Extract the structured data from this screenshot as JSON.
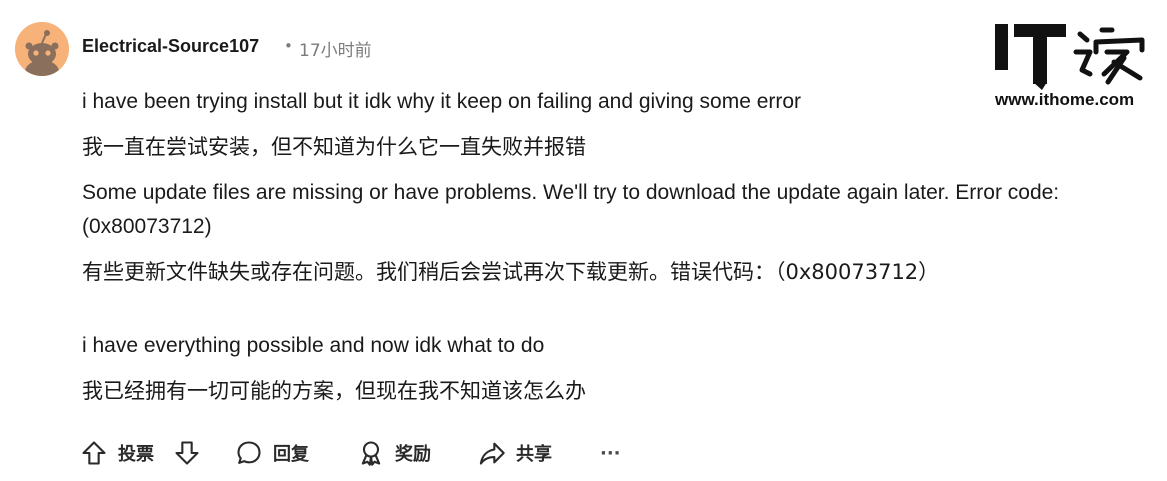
{
  "comment": {
    "author": "Electrical-Source107",
    "separator": "•",
    "time": "17小时前",
    "lines": [
      "i have been trying install but it idk why it keep on failing and giving some error",
      "我一直在尝试安装，但不知道为什么它一直失败并报错",
      "Some update files are missing or have problems. We'll try to download the update again later. Error code:",
      "(0x80073712)",
      "有些更新文件缺失或存在问题。我们稍后会尝试再次下载更新。错误代码：（0x80073712）",
      "i have everything possible and now idk what to do",
      "我已经拥有一切可能的方案，但现在我不知道该怎么办"
    ]
  },
  "actions": {
    "vote_label": "投票",
    "reply_label": "回复",
    "award_label": "奖励",
    "share_label": "共享",
    "more_label": "···"
  },
  "watermark": {
    "logo_text": "IT之家",
    "url": "www.ithome.com"
  },
  "colors": {
    "avatar_bg": "#f7b27a",
    "text": "#1a1a1b",
    "meta": "#7c7c7c"
  }
}
